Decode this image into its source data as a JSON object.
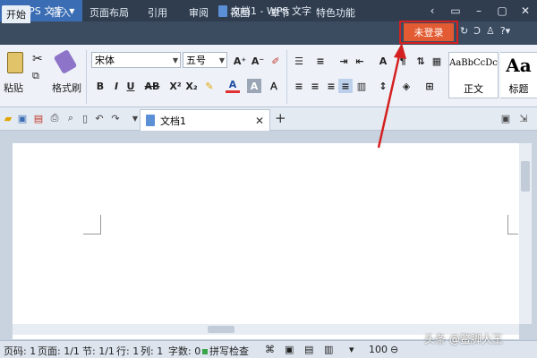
{
  "titlebar": {
    "app_name": "WPS 文字",
    "doc_title": "文档1 - WPS 文字",
    "controls": [
      "‹",
      "▭",
      "–",
      "▢",
      "✕"
    ]
  },
  "tabs": [
    {
      "label": "开始",
      "active": true
    },
    {
      "label": "插入"
    },
    {
      "label": "页面布局"
    },
    {
      "label": "引用"
    },
    {
      "label": "审阅"
    },
    {
      "label": "视图"
    },
    {
      "label": "章节"
    },
    {
      "label": "特色功能"
    }
  ],
  "login_label": "未登录",
  "tab_icons": [
    "↻",
    "Ͻ",
    "♙",
    "?▾"
  ],
  "ribbon": {
    "paste_label": "粘贴",
    "format_painter_label": "格式刷",
    "font_name": "宋体",
    "font_size": "五号",
    "bold": "B",
    "italic": "I",
    "underline": "U",
    "strike": "AB",
    "superscript": "X²",
    "subscript": "X₂",
    "font_color": "A",
    "shade": "A",
    "grow": "A⁺",
    "shrink": "A⁻",
    "style_sample": "AaBbCcDc",
    "style_name": "正文",
    "style_sample2": "Aa",
    "style_name2": "标题"
  },
  "doc_tab": {
    "label": "文档1"
  },
  "statusbar": {
    "page": "页码: 1",
    "pages": "页面: 1/1",
    "section": "节: 1/1",
    "row": "行: 1",
    "col": "列: 1",
    "words": "字数: 0",
    "spell": "拼写检查",
    "zoom": "100"
  },
  "watermark": "头条 @鳖脚大王",
  "colors": {
    "title_bg": "#2f3d4f",
    "accent": "#3a6db4",
    "login": "#e25b32",
    "highlight": "#d42020"
  }
}
